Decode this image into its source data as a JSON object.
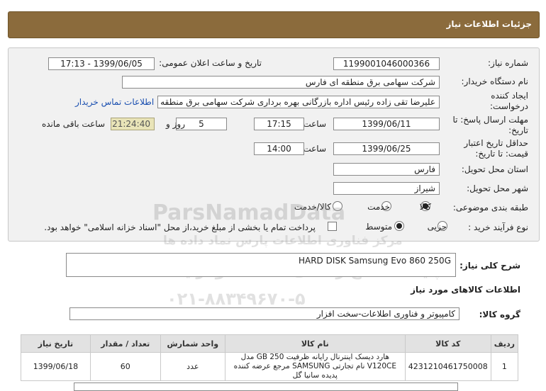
{
  "header": {
    "title": "جزئیات اطلاعات نیاز"
  },
  "form": {
    "need_number_label": "شماره نیاز:",
    "need_number": "1199001046000366",
    "announce_label": "تاریخ و ساعت اعلان عمومی:",
    "announce_value": "1399/06/05 - 17:13",
    "buyer_label": "نام دستگاه خریدار:",
    "buyer_value": "شرکت سهامی برق منطقه ای فارس",
    "creator_label": "ایجاد کننده درخواست:",
    "creator_value": "علیرضا  تقی زاده رئیس اداره بازرگانی بهره برداری شرکت سهامی برق منطقه ای",
    "contact_link": "اطلاعات تماس خریدار",
    "deadline_label": "مهلت ارسال پاسخ: تا تاریخ:",
    "deadline_date": "1399/06/11",
    "time_label": "ساعت",
    "deadline_time": "17:15",
    "days_value": "5",
    "days_label": "روز و",
    "remaining_time": "21:24:40",
    "remaining_label": "ساعت باقی مانده",
    "validity_label": "حداقل تاریخ اعتبار قیمت: تا تاریخ:",
    "validity_date": "1399/06/25",
    "validity_time": "14:00",
    "province_label": "استان محل تحویل:",
    "province_value": "فارس",
    "city_label": "شهر محل تحویل:",
    "city_value": "شیراز",
    "category_label": "طبقه بندی موضوعی:",
    "category_options": [
      "کالا",
      "خدمت",
      "کالا/خدمت"
    ],
    "category_selected": "کالا",
    "process_label": "نوع فرآیند خرید :",
    "process_options": [
      "جزیی",
      "متوسط"
    ],
    "process_selected": "متوسط",
    "payment_note": "پرداخت تمام یا بخشی از مبلغ خرید،از محل \"اسناد خزانه اسلامی\" خواهد بود."
  },
  "summary": {
    "desc_label": "شرح کلی نیاز:",
    "desc_value": "HARD DISK Samsung Evo 860 250G",
    "goods_info_label": "اطلاعات کالاهای مورد نیاز",
    "group_label": "گروه کالا:",
    "group_value": "کامپیوتر و فناوری اطلاعات-سخت افزار"
  },
  "table": {
    "headers": [
      "ردیف",
      "کد کالا",
      "نام کالا",
      "واحد شمارش",
      "تعداد / مقدار",
      "تاریخ نیاز"
    ],
    "rows": [
      {
        "row": "1",
        "code": "4231210461750008",
        "name": "هارد دیسک اینترنال رایانه ظرفیت 250 GB مدل V120CE نام تجارتی SAMSUNG مرجع عرضه کننده پدیده سانیا گل",
        "unit": "عدد",
        "qty": "60",
        "date": "1399/06/18"
      }
    ]
  },
  "watermark": {
    "line1": "ParsNamadData",
    "line2": "مرکز فناوری اطلاعات پارس نماد داده ها",
    "line3": "پایگاه اطلاع رسانی مناقصه ومزایده",
    "line4": "۰۲۱-۸۸۳۴۹۶۷۰-۵"
  },
  "colors": {
    "header_bg": "#8b6b3c",
    "link": "#1a4fb0",
    "timer_bg": "#e9e4b8"
  }
}
